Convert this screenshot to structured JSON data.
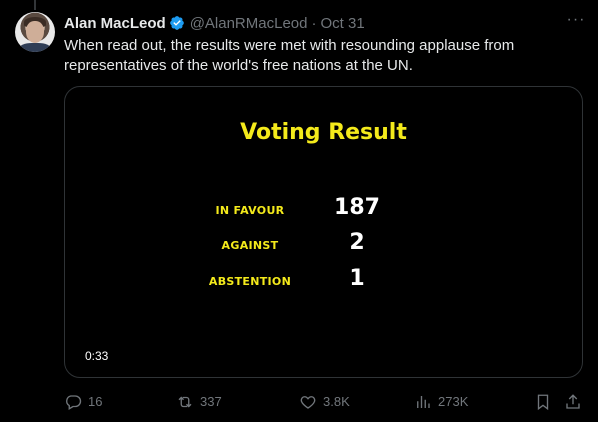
{
  "tweet": {
    "author_name": "Alan MacLeod",
    "handle": "@AlanRMacLeod",
    "separator": "·",
    "date": "Oct 31",
    "text": "When read out, the results were met with resounding applause from representatives of the world's free nations at the UN.",
    "more_label": "···"
  },
  "video": {
    "title": "Voting Result",
    "rows": [
      {
        "label": "IN FAVOUR",
        "value": "187"
      },
      {
        "label": "AGAINST",
        "value": "2"
      },
      {
        "label": "ABSTENTION",
        "value": "1"
      }
    ],
    "timestamp": "0:33"
  },
  "actions": {
    "replies": "16",
    "reposts": "337",
    "likes": "3.8K",
    "views": "273K"
  },
  "colors": {
    "background": "#000000",
    "text_primary": "#e7e9ea",
    "text_secondary": "#71767b",
    "verified_blue": "#1d9bf0",
    "video_yellow": "#f4ea1b"
  },
  "icons": {
    "verified": "verified-badge-icon",
    "more": "more-icon",
    "reply": "reply-icon",
    "repost": "repost-icon",
    "like": "heart-icon",
    "views": "views-icon",
    "bookmark": "bookmark-icon",
    "share": "share-icon"
  }
}
